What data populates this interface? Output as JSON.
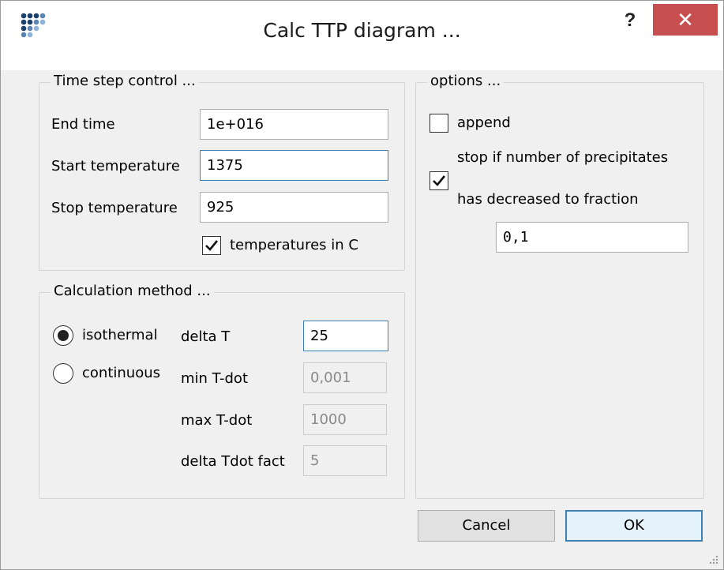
{
  "window": {
    "title": "Calc TTP diagram ...",
    "help_label": "?",
    "close_label": "✕"
  },
  "time_step": {
    "group_title": "Time step control ...",
    "end_time_label": "End time",
    "end_time_value": "1e+016",
    "start_temp_label": "Start temperature",
    "start_temp_value": "1375",
    "stop_temp_label": "Stop temperature",
    "stop_temp_value": "925",
    "temps_in_c_label": "temperatures in C",
    "temps_in_c_checked": true
  },
  "calc_method": {
    "group_title": "Calculation method ...",
    "isothermal_label": "isothermal",
    "continuous_label": "continuous",
    "selected": "isothermal",
    "delta_t_label": "delta T",
    "delta_t_value": "25",
    "min_tdot_label": "min T-dot",
    "min_tdot_value": "0,001",
    "max_tdot_label": "max T-dot",
    "max_tdot_value": "1000",
    "delta_tdot_fact_label": "delta Tdot fact",
    "delta_tdot_fact_value": "5"
  },
  "options": {
    "group_title": "options ...",
    "append_label": "append",
    "append_checked": false,
    "stop_label_line1": "stop if number of precipitates",
    "stop_label_line2": "has decreased to fraction",
    "stop_checked": true,
    "fraction_value": "0,1"
  },
  "buttons": {
    "cancel_label": "Cancel",
    "ok_label": "OK"
  },
  "icons": {
    "app": "app-dots-icon",
    "help": "help-icon",
    "close": "close-icon",
    "check": "checkmark-icon",
    "grip": "resize-grip-icon"
  },
  "colors": {
    "close_bg": "#c74f50",
    "focus_border": "#3c7fb1",
    "dialog_bg": "#f0f0f0"
  }
}
